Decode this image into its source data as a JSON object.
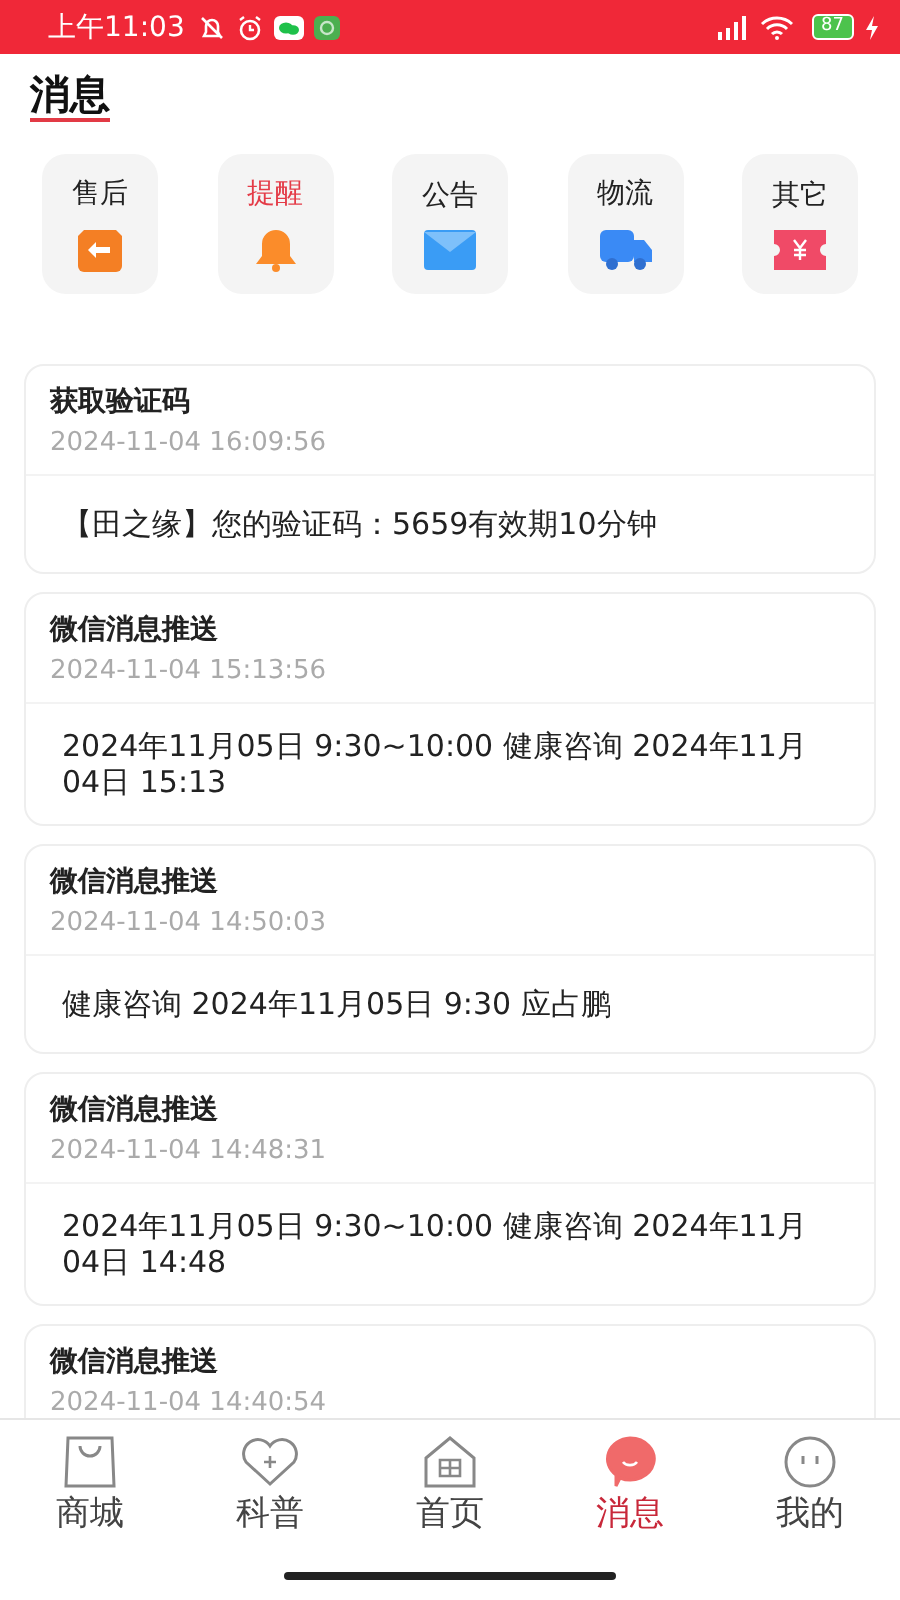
{
  "status_bar": {
    "time": "上午11:03",
    "battery": "87"
  },
  "page_title": "消息",
  "categories": [
    {
      "label": "售后",
      "kind": "return",
      "selected": false
    },
    {
      "label": "提醒",
      "kind": "bell",
      "selected": true
    },
    {
      "label": "公告",
      "kind": "mail",
      "selected": false
    },
    {
      "label": "物流",
      "kind": "truck",
      "selected": false
    },
    {
      "label": "其它",
      "kind": "ticket",
      "selected": false
    }
  ],
  "messages": [
    {
      "title": "获取验证码",
      "time": "2024-11-04 16:09:56",
      "body": "【田之缘】您的验证码：5659有效期10分钟"
    },
    {
      "title": "微信消息推送",
      "time": "2024-11-04 15:13:56",
      "body": "2024年11月05日 9:30~10:00 健康咨询 2024年11月04日 15:13"
    },
    {
      "title": "微信消息推送",
      "time": "2024-11-04 14:50:03",
      "body": "健康咨询 2024年11月05日 9:30 应占鹏"
    },
    {
      "title": "微信消息推送",
      "time": "2024-11-04 14:48:31",
      "body": "2024年11月05日 9:30~10:00 健康咨询 2024年11月04日 14:48"
    },
    {
      "title": "微信消息推送",
      "time": "2024-11-04 14:40:54"
    }
  ],
  "tab_bar": [
    {
      "label": "商城",
      "kind": "bag",
      "selected": false
    },
    {
      "label": "科普",
      "kind": "heart",
      "selected": false
    },
    {
      "label": "首页",
      "kind": "home",
      "selected": false
    },
    {
      "label": "消息",
      "kind": "chat",
      "selected": true
    },
    {
      "label": "我的",
      "kind": "face",
      "selected": false
    }
  ]
}
